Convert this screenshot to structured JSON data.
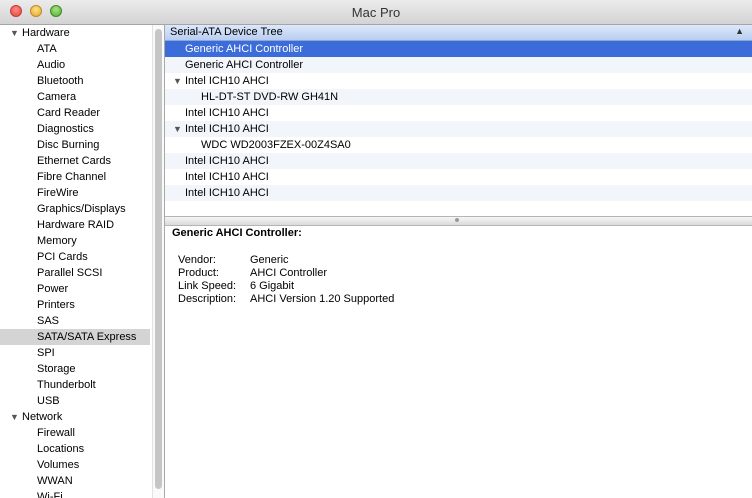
{
  "window": {
    "title": "Mac Pro"
  },
  "sidebar": {
    "sections": [
      {
        "label": "Hardware",
        "items": [
          "ATA",
          "Audio",
          "Bluetooth",
          "Camera",
          "Card Reader",
          "Diagnostics",
          "Disc Burning",
          "Ethernet Cards",
          "Fibre Channel",
          "FireWire",
          "Graphics/Displays",
          "Hardware RAID",
          "Memory",
          "PCI Cards",
          "Parallel SCSI",
          "Power",
          "Printers",
          "SAS",
          "SATA/SATA Express",
          "SPI",
          "Storage",
          "Thunderbolt",
          "USB"
        ]
      },
      {
        "label": "Network",
        "items": [
          "Firewall",
          "Locations",
          "Volumes",
          "WWAN",
          "Wi-Fi"
        ]
      }
    ],
    "selected": "SATA/SATA Express"
  },
  "tree": {
    "header": "Serial-ATA Device Tree",
    "rows": [
      {
        "label": "Generic AHCI Controller",
        "level": 1,
        "expandable": false,
        "selected": true
      },
      {
        "label": "Generic AHCI Controller",
        "level": 1,
        "expandable": false
      },
      {
        "label": "Intel ICH10 AHCI",
        "level": 1,
        "expandable": true
      },
      {
        "label": "HL-DT-ST DVD-RW GH41N",
        "level": 2,
        "expandable": false
      },
      {
        "label": "Intel ICH10 AHCI",
        "level": 1,
        "expandable": false
      },
      {
        "label": "Intel ICH10 AHCI",
        "level": 1,
        "expandable": true
      },
      {
        "label": "WDC WD2003FZEX-00Z4SA0",
        "level": 2,
        "expandable": false
      },
      {
        "label": "Intel ICH10 AHCI",
        "level": 1,
        "expandable": false
      },
      {
        "label": "Intel ICH10 AHCI",
        "level": 1,
        "expandable": false
      },
      {
        "label": "Intel ICH10 AHCI",
        "level": 1,
        "expandable": false
      }
    ]
  },
  "detail": {
    "title": "Generic AHCI Controller:",
    "properties": [
      {
        "key": "Vendor:",
        "value": "Generic"
      },
      {
        "key": "Product:",
        "value": "AHCI Controller"
      },
      {
        "key": "Link Speed:",
        "value": "6 Gigabit"
      },
      {
        "key": "Description:",
        "value": "AHCI Version 1.20 Supported"
      }
    ]
  },
  "colors": {
    "selection": "#3b6cd9",
    "sidebar_selection": "#d4d4d4",
    "header_gradient_top": "#dce8fb"
  }
}
